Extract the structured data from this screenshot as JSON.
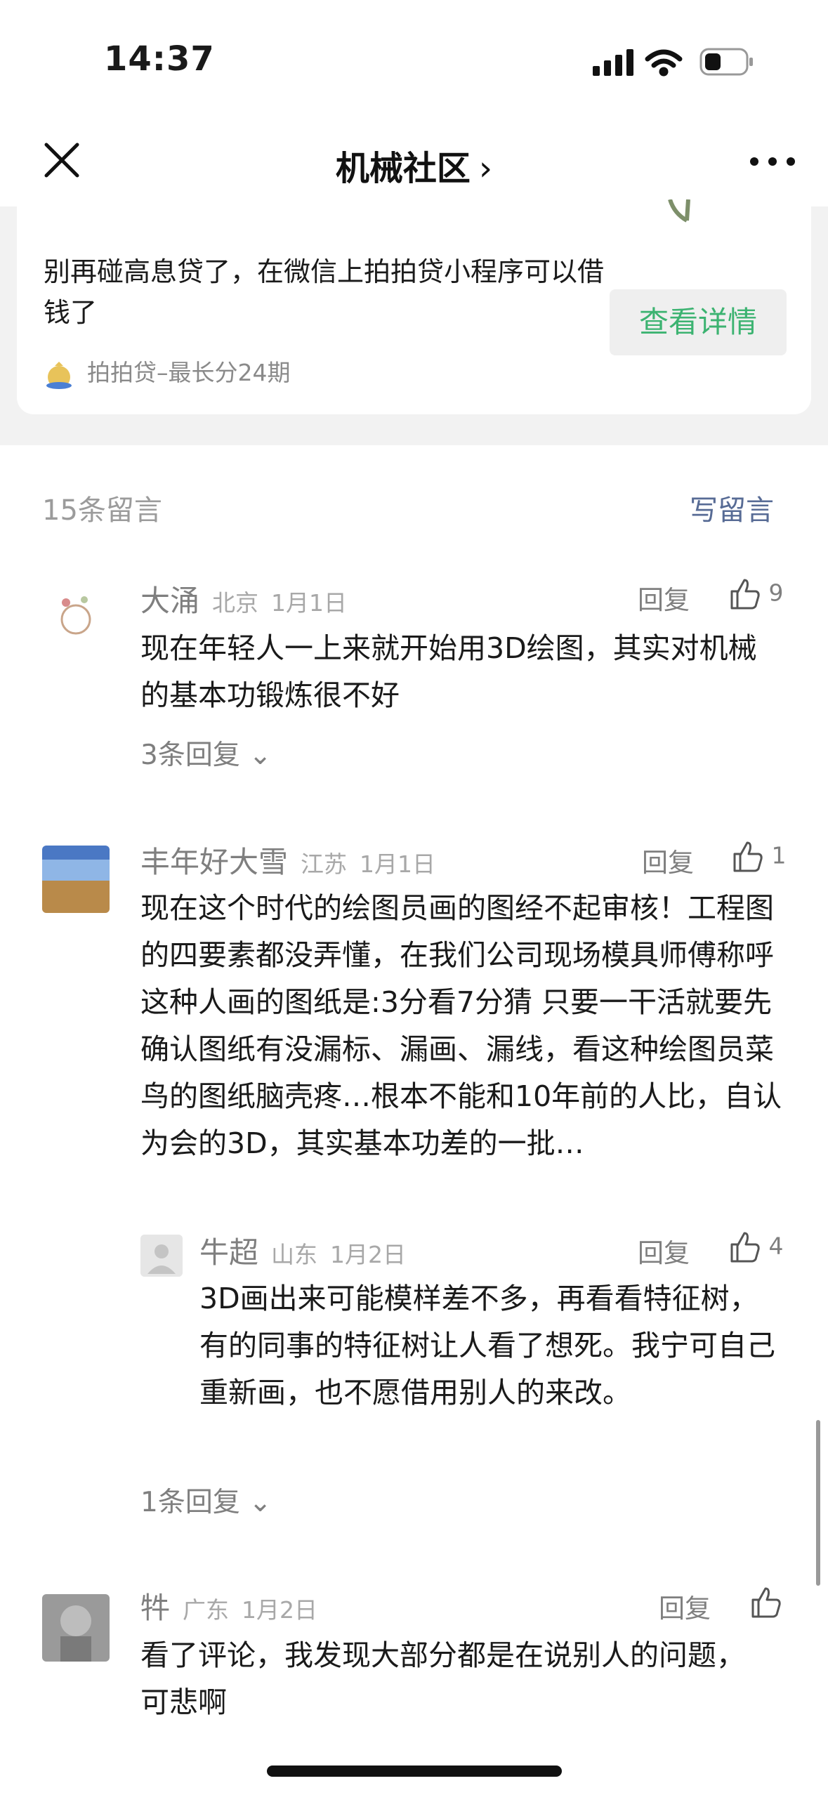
{
  "status_bar": {
    "time": "14:37"
  },
  "nav": {
    "title": "机械社区",
    "title_chevron": "›"
  },
  "ad": {
    "text": "别再碰高息贷了，在微信上拍拍贷小程序可以借钱了",
    "button_label": "查看详情",
    "source": "拍拍贷–最长分24期"
  },
  "comments_header": {
    "count": "15条留言",
    "write_label": "写留言"
  },
  "comments": [
    {
      "name": "大涌",
      "location": "北京",
      "date": "1月1日",
      "reply_label": "回复",
      "likes": "9",
      "text": "现在年轻人一上来就开始用3D绘图，其实对机械的基本功锻炼很不好",
      "more_replies": "3条回复 ⌄"
    },
    {
      "name": "丰年好大雪",
      "location": "江苏",
      "date": "1月1日",
      "reply_label": "回复",
      "likes": "1",
      "text": "现在这个时代的绘图员画的图经不起审核！工程图的四要素都没弄懂，在我们公司现场模具师傅称呼这种人画的图纸是:3分看7分猜   只要一干活就要先确认图纸有没漏标、漏画、漏线，看这种绘图员菜鸟的图纸脑壳疼…根本不能和10年前的人比，自认为会的3D，其实基本功差的一批…",
      "reply": {
        "name": "牛超",
        "location": "山东",
        "date": "1月2日",
        "reply_label": "回复",
        "likes": "4",
        "text": "3D画出来可能模样差不多，再看看特征树，有的同事的特征树让人看了想死。我宁可自己重新画，也不愿借用别人的来改。"
      },
      "more_replies": "1条回复 ⌄"
    },
    {
      "name": "牪",
      "location": "广东",
      "date": "1月2日",
      "reply_label": "回复",
      "likes": "",
      "text": "看了评论，我发现大部分都是在说别人的问题，可悲啊"
    }
  ],
  "colors": {
    "accent_green": "#3cb371",
    "link_blue": "#576b95"
  }
}
